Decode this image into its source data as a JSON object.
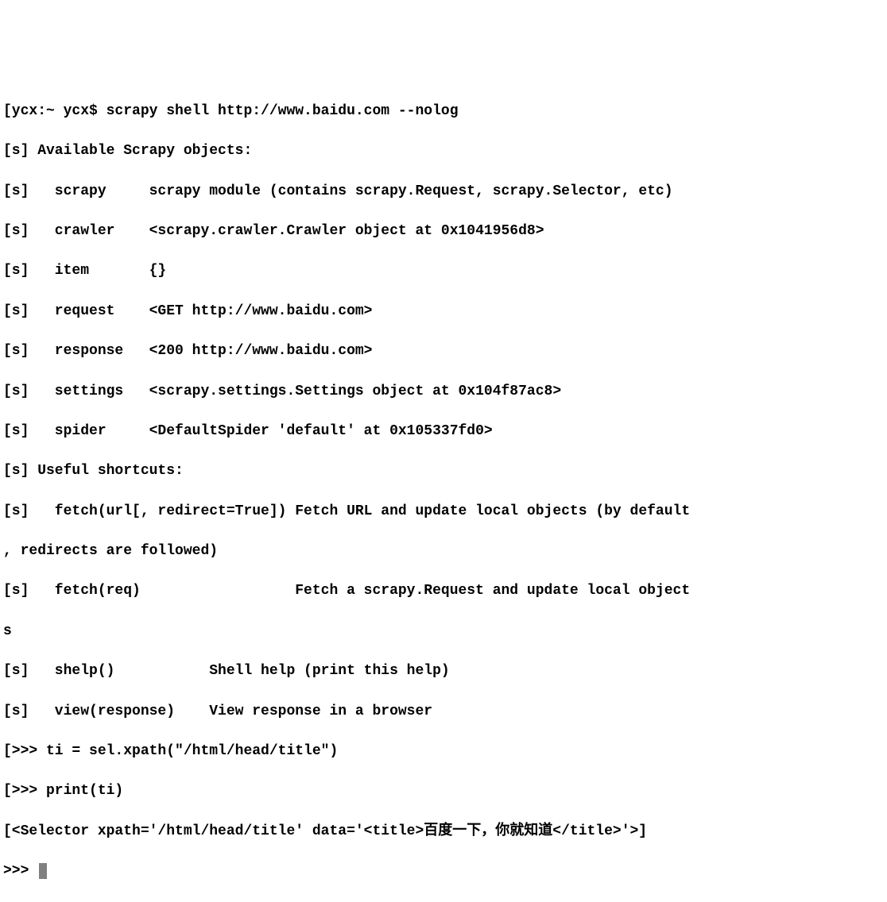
{
  "lines": [
    "[ycx:~ ycx$ scrapy shell http://www.baidu.com --nolog",
    "[s] Available Scrapy objects:",
    "[s]   scrapy     scrapy module (contains scrapy.Request, scrapy.Selector, etc)",
    "[s]   crawler    <scrapy.crawler.Crawler object at 0x1041956d8>",
    "[s]   item       {}",
    "[s]   request    <GET http://www.baidu.com>",
    "[s]   response   <200 http://www.baidu.com>",
    "[s]   settings   <scrapy.settings.Settings object at 0x104f87ac8>",
    "[s]   spider     <DefaultSpider 'default' at 0x105337fd0>",
    "[s] Useful shortcuts:",
    "[s]   fetch(url[, redirect=True]) Fetch URL and update local objects (by default",
    ", redirects are followed)",
    "[s]   fetch(req)                  Fetch a scrapy.Request and update local object",
    "s",
    "[s]   shelp()           Shell help (print this help)",
    "[s]   view(response)    View response in a browser",
    "[>>> ti = sel.xpath(\"/html/head/title\")",
    "[>>> print(ti)",
    "[<Selector xpath='/html/head/title' data='<title>百度一下，你就知道</title>'>]"
  ],
  "prompt": ">>> "
}
